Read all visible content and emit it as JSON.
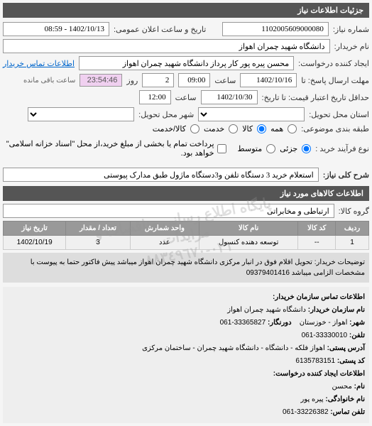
{
  "header": {
    "title": "جزئیات اطلاعات نیاز"
  },
  "form": {
    "number_label": "شماره نیاز:",
    "number_value": "1102005609000080",
    "announce_label": "تاریخ و ساعت اعلان عمومی:",
    "announce_value": "1402/10/13 - 08:59",
    "buyer_label": "نام خریدار:",
    "buyer_value": "دانشگاه شهید چمران اهواز",
    "creator_label": "ایجاد کننده درخواست:",
    "creator_value": "محسن پیره پور کار پرداز دانشگاه شهید چمران اهواز",
    "contact_link": "اطلاعات تماس خریدار",
    "deadline_label": "مهلت ارسال پاسخ: تا",
    "deadline_date": "1402/10/16",
    "time_label": "ساعت",
    "deadline_time": "09:00",
    "day_label": "روز",
    "days_value": "2",
    "remaining_time": "23:54:46",
    "remaining_label": "ساعت باقی مانده",
    "validity_label": "حداقل تاریخ اعتبار قیمت: تا تاریخ:",
    "validity_date": "1402/10/30",
    "validity_time": "12:00",
    "delivery_state_label": "استان محل تحویل:",
    "delivery_city_label": "شهر محل تحویل:",
    "category_label": "طبقه بندی موضوعی:",
    "radio_all": "همه",
    "radio_goods": "کالا",
    "radio_service": "خدمت",
    "radio_mixed": "کالا/خدمت",
    "purchase_type_label": "نوع فرآیند خرید :",
    "radio_small": "جزئی",
    "radio_medium": "متوسط",
    "checkbox_label": "پرداخت تمام یا بخشی از مبلغ خرید،از محل \"اسناد خزانه اسلامی\" خواهد بود.",
    "desc_label": "شرح کلی نیاز:",
    "desc_value": "استعلام خرید 3 دستگاه تلفن و3دستگاه ماژول طبق مدارک پیوستی"
  },
  "goods": {
    "title": "اطلاعات کالاهای مورد نیاز",
    "group_label": "گروه کالا:",
    "group_value": "ارتباطی و مخابراتی",
    "headers": {
      "row": "ردیف",
      "code": "کد کالا",
      "name": "نام کالا",
      "unit": "واحد شمارش",
      "qty": "تعداد / مقدار",
      "date": "تاریخ نیاز"
    },
    "items": [
      {
        "row": "1",
        "code": "--",
        "name": "توسعه دهنده کنسول",
        "unit": "عدد",
        "qty": "3",
        "date": "1402/10/19"
      }
    ]
  },
  "notes": {
    "delivery_label": "توضیحات خریدار:",
    "delivery_text": "تحویل اقلام فوق در انبار مرکزی دانشگاه شهید چمران اهواز میباشد پیش فاکتور حتما به پیوست با مشخصات الزامی میباشد 09379401416"
  },
  "contact": {
    "title": "اطلاعات تماس سازمان خریدار:",
    "org_label": "نام سازمان خریدار:",
    "org_value": "دانشگاه شهید چمران اهواز",
    "city_label": "شهر:",
    "city_value": "اهواز",
    "province_label": "- خوزستان",
    "fax_label": "دورنگار:",
    "fax_value": "33365827-061",
    "phone_label": "تلفن:",
    "phone_value": "33330010-061",
    "address_label": "آدرس پستی:",
    "address_value": "اهواز فلکه - دانشگاه - دانشگاه شهید چمران - ساختمان مرکزی",
    "postal_label": "کد پستی:",
    "postal_value": "6135783151",
    "creator_title": "اطلاعات ایجاد کننده درخواست:",
    "name_label": "نام:",
    "name_value": "محسن",
    "family_label": "نام خانوادگی:",
    "family_value": "پیره پور",
    "contact_phone_label": "تلفن تماس:",
    "contact_phone_value": "33226382-061"
  },
  "watermark": {
    "line1": "پایگاه اطلاع رسانی مناقصات و مزایدات",
    "line2": "٠٢١-٨٨٣٤٩٦٧٠"
  }
}
